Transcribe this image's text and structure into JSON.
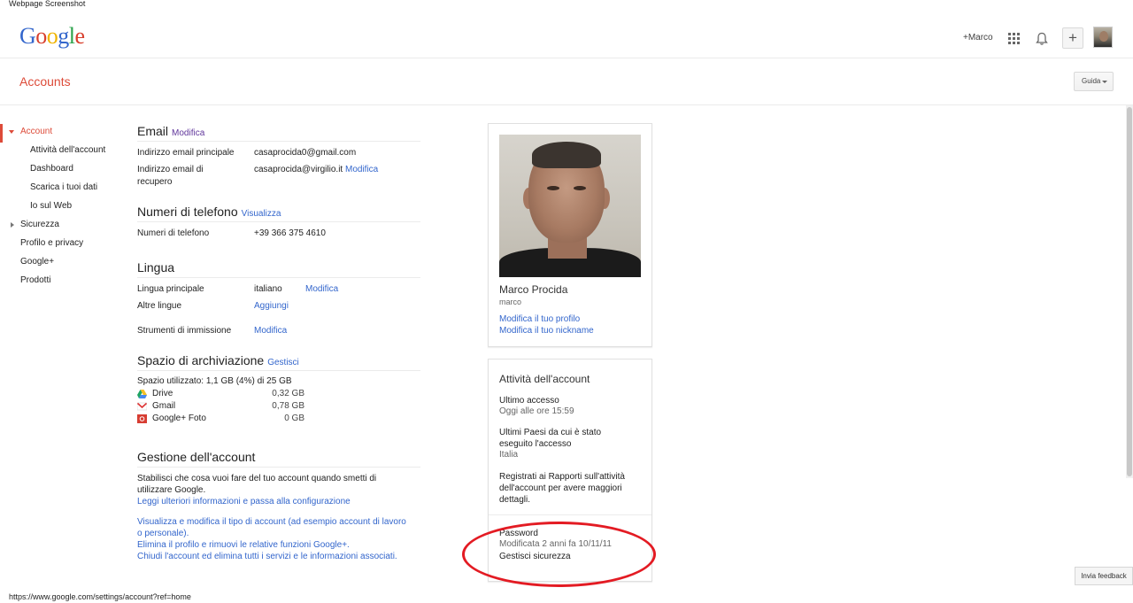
{
  "caption": "Webpage Screenshot",
  "header": {
    "logo_letters": [
      "G",
      "o",
      "o",
      "g",
      "l",
      "e"
    ],
    "plus_user": "+Marco",
    "share_symbol": "+"
  },
  "accounts_bar": {
    "title": "Accounts",
    "help_label": "Guida"
  },
  "sidebar": {
    "items": [
      {
        "label": "Account"
      },
      {
        "label": "Attività dell'account"
      },
      {
        "label": "Dashboard"
      },
      {
        "label": "Scarica i tuoi dati"
      },
      {
        "label": "Io sul Web"
      },
      {
        "label": "Sicurezza"
      },
      {
        "label": "Profilo e privacy"
      },
      {
        "label": "Google+"
      },
      {
        "label": "Prodotti"
      }
    ]
  },
  "email": {
    "title": "Email",
    "edit": "Modifica",
    "primary_label": "Indirizzo email principale",
    "primary_value": "casaprocida0@gmail.com",
    "recovery_label": "Indirizzo email di recupero",
    "recovery_value": "casaprocida@virgilio.it",
    "recovery_edit": "Modifica"
  },
  "phone": {
    "title": "Numeri di telefono",
    "view": "Visualizza",
    "label": "Numeri di telefono",
    "value": "+39 366 375 4610"
  },
  "language": {
    "title": "Lingua",
    "primary_label": "Lingua principale",
    "primary_value": "italiano",
    "primary_edit": "Modifica",
    "other_label": "Altre lingue",
    "other_add": "Aggiungi",
    "input_label": "Strumenti di immissione",
    "input_edit": "Modifica"
  },
  "storage": {
    "title": "Spazio di archiviazione",
    "manage": "Gestisci",
    "used": "Spazio utilizzato: 1,1 GB (4%) di 25 GB",
    "services": [
      {
        "name": "Drive",
        "size": "0,32 GB"
      },
      {
        "name": "Gmail",
        "size": "0,78 GB"
      },
      {
        "name": "Google+ Foto",
        "size": "0 GB"
      }
    ]
  },
  "management": {
    "title": "Gestione dell'account",
    "desc": "Stabilisci che cosa vuoi fare del tuo account quando smetti di utilizzare Google.",
    "learn": "Leggi ulteriori informazioni e passa alla configurazione",
    "view_type": "Visualizza e modifica il tipo di account (ad esempio account di lavoro o personale).",
    "delete_profile": "Elimina il profilo e rimuovi le relative funzioni Google+.",
    "close_account": "Chiudi l'account ed elimina tutti i servizi e le informazioni associati."
  },
  "profile": {
    "name": "Marco Procida",
    "nickname": "marco",
    "edit_profile": "Modifica il tuo profilo",
    "edit_nickname": "Modifica il tuo nickname"
  },
  "activity": {
    "title": "Attività dell'account",
    "last_access_label": "Ultimo accesso",
    "last_access_value": "Oggi alle ore 15:59",
    "countries_label": "Ultimi Paesi da cui è stato eseguito l'accesso",
    "countries_value": "Italia",
    "reports_link": "Registrati ai Rapporti sull'attività dell'account per avere maggiori dettagli.",
    "password_label": "Password",
    "password_value": "Modificata 2 anni fa 10/11/11",
    "security_link": "Gestisci sicurezza"
  },
  "status_url": "https://www.google.com/settings/account?ref=home",
  "feedback": "Invia feedback",
  "colors": {
    "accent": "#dd4b39",
    "link": "#3366cc",
    "annotation": "#e31b23"
  }
}
